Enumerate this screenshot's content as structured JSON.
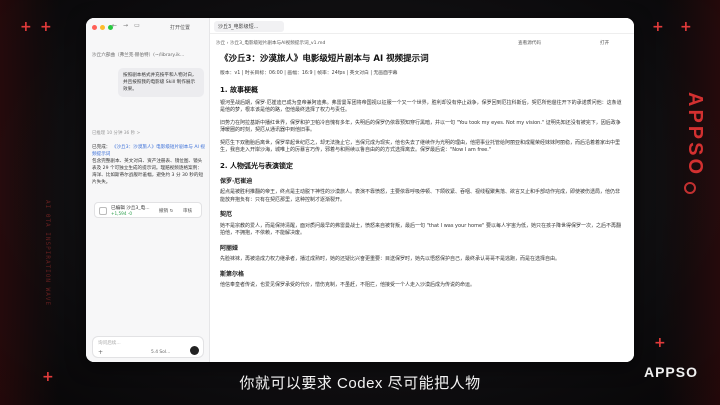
{
  "sidebar": {
    "open_label": "打开位置",
    "breadcrumb": "沙丘六部曲（弗兰克·赫伯特）(~/library.ik...",
    "user_message": "按照剧本格式并充按平和人物对白，并且按照我的电影级 Skill 制作展示效果。",
    "thought": "已推理 10 分钟 36 秒 >",
    "reply_prefix": "已完成：",
    "reply_link": "《沙丘3：沙漠旅人》电影级短片剧本与 AI 视频提示词",
    "reply_body": "包含完整剧本、英文对白、资产注册表、镜位图、镜头表及 29 个可独立生成的提示词。理赔视频逐格案例：海洋、比如斯蒂尔战舰叶羞幅，避免约 3 分 30 秒的短片失失。",
    "edit_card_title": "已编辑 沙丘3_电...",
    "edit_card_diff": "+1,594 -0",
    "edit_card_undo": "撤销 ↻",
    "edit_card_review": "审核",
    "compose_placeholder": "询问后续...",
    "model_label": "5.4 Sol..."
  },
  "main": {
    "tab_label": "沙丘3_电影级短...",
    "path": "沙丘 › 沙丘3_电影级短片剧本与AI视频提示词_v1.md",
    "view_code": "查看源代码",
    "open_label": "打开",
    "title": "《沙丘3：沙漠旅人》电影级短片剧本与 AI 视频提示词",
    "meta": "版本：v1 | 时长目标：06:00 | 画幅：16:9 | 帧率：24fps | 英文对白 | 无画面字幕",
    "section1": "1. 故事梗概",
    "s1_p1": "银河圣战后期，保罗·厄崔迪已成为皇帝兼阿迪弗。弗雷曼军团将帝国视以征服一个又一个世界，胜利却没有停止战争，保罗回到厄拉科斯后，契厄所他爸往开下的承诺质问他：这条道是他的梦，根本该是他的路，但他最终选择了权力与责任。",
    "s1_p2": "旧势力在阿拉基斯中播红世界，保罗和护卫帕冷自愧有多年，失明后的保罗仍依靠预知穿行黑暗，并以一句 \"You took my eyes. Not my vision.\" 证明先知还没有被完下，因后政争薄暖圈的时刻，契厄从通讯器中到他旧事。",
    "s1_p3": "契厄生下双胞胎后离世，保罗举起世纪厄之，却无法挽止它，当保兄成为现实，他也失去了继续作为光明的理由，他把事业托管给阿丽亚和成羅荣经妹妹阿丽稳，而后沿着着家出中里生，我自走入开岸沙海，城唯上的厉暴言巧传，邪着与和熙续以鲁自由的的方式选择离去。保罗最后说：\"Now I am free.\"",
    "section2": "2. 人物弧光与表演锁定",
    "char1": "保罗·厄崔迪",
    "char1_p": "起点是被胜利推翻的帝王，终点是主动脱下神性的沙漠旅人。表演不靠愤怒，主要依靠呼吸停顿、下颌收紧、吞咽、视线程聚焦落、欲言又止和手部动作完成，即使被伤透局，他仍非能放弃抱负有：只有在契厄那里，这种控制才逐渐裂开。",
    "char2": "契厄",
    "char2_p": "她不是宗教的爱人，而是保持清醒，面对质问最早的弗雷曼战士，愤怒来自被背叛，最后一句 \"that I was your home\" 要以每人宇宙为低，她只在孩子降世得保罗一次，之后不再翻拍他，不拥抱，不依赖，不能解决废。",
    "char3": "阿丽娅",
    "char3_p": "先脸袜袜，再被造成力权力继承者，播过成熟时，她的还疑比兴奋更重要：目送保罗时，她先以悟怒保护自己，最终承认哥哥不是逃跑，而是在选择自由。",
    "char4": "斯第尔格",
    "char4_p": "他信奉皇者传说，也爱见保罗承受的代价，憎伤克制，不虽赶，不阻拦，他接受一个人走入沙漠后成为传说的命运。"
  },
  "overlay": {
    "subtitle": "你就可以要求 Codex 尽可能把人物",
    "logo": "APPSO",
    "side_logo": "APPSO",
    "deco_text": "AI 0TA INSPIRATION WAVE"
  }
}
